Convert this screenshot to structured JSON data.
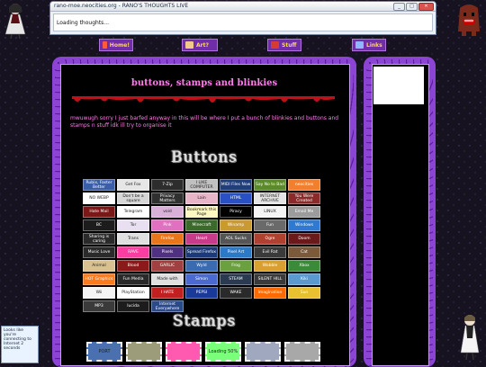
{
  "window": {
    "title": "rano-moe.neocities.org - RANO'S THOUGHTS LIVE",
    "message": "Loading thoughts...",
    "controls": [
      "_",
      "□",
      "✕"
    ]
  },
  "nav": [
    {
      "label": "Home!",
      "icon": "house-icon",
      "color": "#ff5a3c"
    },
    {
      "label": "Art?",
      "icon": "art-icon",
      "color": "#f2c98a"
    },
    {
      "label": "Stuff",
      "icon": "stuff-icon",
      "color": "#d63b2f"
    },
    {
      "label": "Links",
      "icon": "links-icon",
      "color": "#8db8ff"
    }
  ],
  "content": {
    "title": "buttons, stamps and blinkies",
    "intro": "mwuwugh sorry I just barfed anyway in this will be where I put a bunch of blinkies and buttons and stamps n stuff idk ill try to organise it",
    "buttons_heading": "Buttons",
    "stamps_heading": "Stamps"
  },
  "buttons": [
    {
      "label": "Rubix, Faster Better",
      "bg": "#3a5fa8"
    },
    {
      "label": "Get Fox",
      "bg": "#e6e6e6"
    },
    {
      "label": "7-Zip",
      "bg": "#2d2d2d"
    },
    {
      "label": "I LIKE COMPUTER",
      "bg": "#c0c0c0"
    },
    {
      "label": "MIDI Files Now",
      "bg": "#1f3e7a"
    },
    {
      "label": "Say No to Bad",
      "bg": "#5a8a2a"
    },
    {
      "label": "neocities",
      "bg": "#f08030"
    },
    {
      "label": "NO WEBP",
      "bg": "#ffffff"
    },
    {
      "label": "Don't be a square",
      "bg": "#d6d6d6"
    },
    {
      "label": "Privacy Matters",
      "bg": "#303030"
    },
    {
      "label": "Lain",
      "bg": "#e8b4c8"
    },
    {
      "label": "HTML",
      "bg": "#2a50c8"
    },
    {
      "label": "INTERNET ARCHIVE",
      "bg": "#e4e4e4"
    },
    {
      "label": "You Were Created",
      "bg": "#8a2a2a"
    },
    {
      "label": "Hate Mail",
      "bg": "#7a1818"
    },
    {
      "label": "Telegram",
      "bg": "#ffffff"
    },
    {
      "label": "void",
      "bg": "#d8b0d8"
    },
    {
      "label": "Bookmark this Page",
      "bg": "#fff7c0"
    },
    {
      "label": "Piracy",
      "bg": "#000000"
    },
    {
      "label": "LINUX",
      "bg": "#f4f4f4"
    },
    {
      "label": "Email Me",
      "bg": "#9c9c9c"
    },
    {
      "label": "BC",
      "bg": "#1c1c1c"
    },
    {
      "label": "Tor",
      "bg": "#e8e0f0"
    },
    {
      "label": "Pink",
      "bg": "#e070c0"
    },
    {
      "label": "Minecraft",
      "bg": "#3c6a2a"
    },
    {
      "label": "Winamp",
      "bg": "#c89a30"
    },
    {
      "label": "Fun",
      "bg": "#6a6a6a"
    },
    {
      "label": "Windows",
      "bg": "#2f7ad0"
    },
    {
      "label": "Sharing is caring",
      "bg": "#2a2a2a"
    },
    {
      "label": "Trans",
      "bg": "#e0e0e0"
    },
    {
      "label": "Firefox",
      "bg": "#e8761c"
    },
    {
      "label": "Heart",
      "bg": "#c83a8a"
    },
    {
      "label": "AOL Sucks",
      "bg": "#555555"
    },
    {
      "label": "Ogre",
      "bg": "#b04030"
    },
    {
      "label": "Doom",
      "bg": "#6a1a1a"
    },
    {
      "label": "Music Love",
      "bg": "#2a2a2a"
    },
    {
      "label": "RAVE",
      "bg": "#ff3ca0"
    },
    {
      "label": "Pixels",
      "bg": "#503080"
    },
    {
      "label": "Spread Firefox",
      "bg": "#1c3a7a"
    },
    {
      "label": "Pixel Art",
      "bg": "#2a7ac8"
    },
    {
      "label": "Evil Rat",
      "bg": "#3a3a3a"
    },
    {
      "label": "Cat",
      "bg": "#7a5a3a"
    },
    {
      "label": "Animal",
      "bg": "#d8c090"
    },
    {
      "label": "Blood",
      "bg": "#8a1a1a"
    },
    {
      "label": "GARLIC",
      "bg": "#a04040"
    },
    {
      "label": "Wyld",
      "bg": "#3a6ab0"
    },
    {
      "label": "Frog",
      "bg": "#6aa040"
    },
    {
      "label": "Wobble",
      "bg": "#d8a030"
    },
    {
      "label": "Xbox",
      "bg": "#3a8a3a"
    },
    {
      "label": "HOT Graphics",
      "bg": "#ff7a1a"
    },
    {
      "label": "Fun Media",
      "bg": "#2a2a2a"
    },
    {
      "label": "Made with",
      "bg": "#e0e0e0"
    },
    {
      "label": "Simon",
      "bg": "#4a6ad0"
    },
    {
      "label": "STEAM",
      "bg": "#2a3a50"
    },
    {
      "label": "SILENT HILL",
      "bg": "#3a3a3a"
    },
    {
      "label": "Kiki",
      "bg": "#5a9ad0"
    },
    {
      "label": "Wii",
      "bg": "#f4f4f4"
    },
    {
      "label": "PlayStation",
      "bg": "#ffffff"
    },
    {
      "label": "I HATE",
      "bg": "#c02020"
    },
    {
      "label": "PEPSI",
      "bg": "#1a3a9a"
    },
    {
      "label": "WAKE",
      "bg": "#2a2a2a"
    },
    {
      "label": "Imagination",
      "bg": "#ff6a00"
    },
    {
      "label": "Sun",
      "bg": "#e8c030"
    },
    {
      "label": "MP3",
      "bg": "#3a3a3a"
    },
    {
      "label": "lucida",
      "bg": "#1c1c1c"
    },
    {
      "label": "Internet Everywhere",
      "bg": "#2a4a8a"
    }
  ],
  "stamps": [
    {
      "label": "PORT",
      "bg": "#4a70b0"
    },
    {
      "label": "",
      "bg": "#9c9c7a"
    },
    {
      "label": "",
      "bg": "#ff5ab0"
    },
    {
      "label": "Loading 50%",
      "bg": "#7aff7a"
    },
    {
      "label": "",
      "bg": "#a0a8c0"
    },
    {
      "label": "",
      "bg": "#a8a8a8"
    }
  ],
  "corner_badge": "Looks like you're connecting to Internet 2 seconds"
}
